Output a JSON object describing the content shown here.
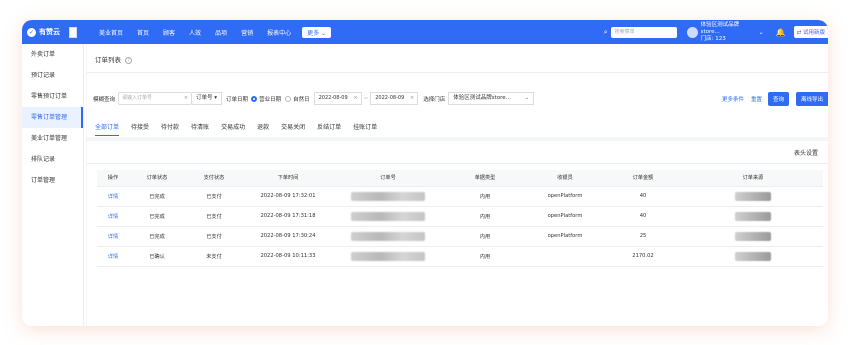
{
  "topbar": {
    "logo_text": "有赞云",
    "nav": [
      "美业首页",
      "首页",
      "顾客",
      "人效",
      "品项",
      "营销",
      "报表中心"
    ],
    "more_label": "更多",
    "search_placeholder": "搜索菜单",
    "store_name": "体验区测试品牌store...",
    "store_sub": "门店: 123",
    "trial_label": "试用新版"
  },
  "sidebar": {
    "items": [
      "外卖订单",
      "预订记录",
      "零售预订订单",
      "零售订单管理",
      "美业订单管理",
      "排队记录",
      "订单管理"
    ],
    "active_index": 3
  },
  "page": {
    "title": "订单列表",
    "filters": {
      "fuzzy_label": "模糊查询",
      "fuzzy_placeholder": "请输入订单号",
      "order_no_select": "订单号",
      "date_label": "订单日期",
      "radio_business": "营业日期",
      "radio_natural": "自然日",
      "date_start": "2022-08-09",
      "date_end": "2022-08-09",
      "store_label": "选择门店",
      "store_value": "体验区测试品牌store..."
    },
    "actions": {
      "more_conditions": "更多条件",
      "reset": "重置",
      "query": "查询",
      "export": "离线导出"
    },
    "tabs": [
      "全部订单",
      "待接受",
      "待付款",
      "待清账",
      "交易成功",
      "退款",
      "交易关闭",
      "反结订单",
      "挂账订单"
    ],
    "active_tab": 0,
    "column_settings": "表头设置"
  },
  "table": {
    "headers": [
      "操作",
      "订单状态",
      "支付状态",
      "下单时间",
      "订单号",
      "单据类型",
      "收银员",
      "订单金额",
      "订单来源"
    ],
    "rows": [
      {
        "action": "详情",
        "order_status": "已完成",
        "pay_status": "已支付",
        "time": "2022-08-09 17:32:01",
        "doc_type": "内用",
        "cashier": "openPlatform",
        "amount": "40"
      },
      {
        "action": "详情",
        "order_status": "已完成",
        "pay_status": "已支付",
        "time": "2022-08-09 17:31:18",
        "doc_type": "内用",
        "cashier": "openPlatform",
        "amount": "40"
      },
      {
        "action": "详情",
        "order_status": "已完成",
        "pay_status": "已支付",
        "time": "2022-08-09 17:30:24",
        "doc_type": "内用",
        "cashier": "openPlatform",
        "amount": "25"
      },
      {
        "action": "详情",
        "order_status": "已确认",
        "pay_status": "未支付",
        "time": "2022-08-09 10:11:33",
        "doc_type": "内用",
        "cashier": "",
        "amount": "2170.02"
      }
    ]
  },
  "colors": {
    "brand": "#2f6bf5",
    "sidebar_active_bg": "#eaf1ff"
  }
}
